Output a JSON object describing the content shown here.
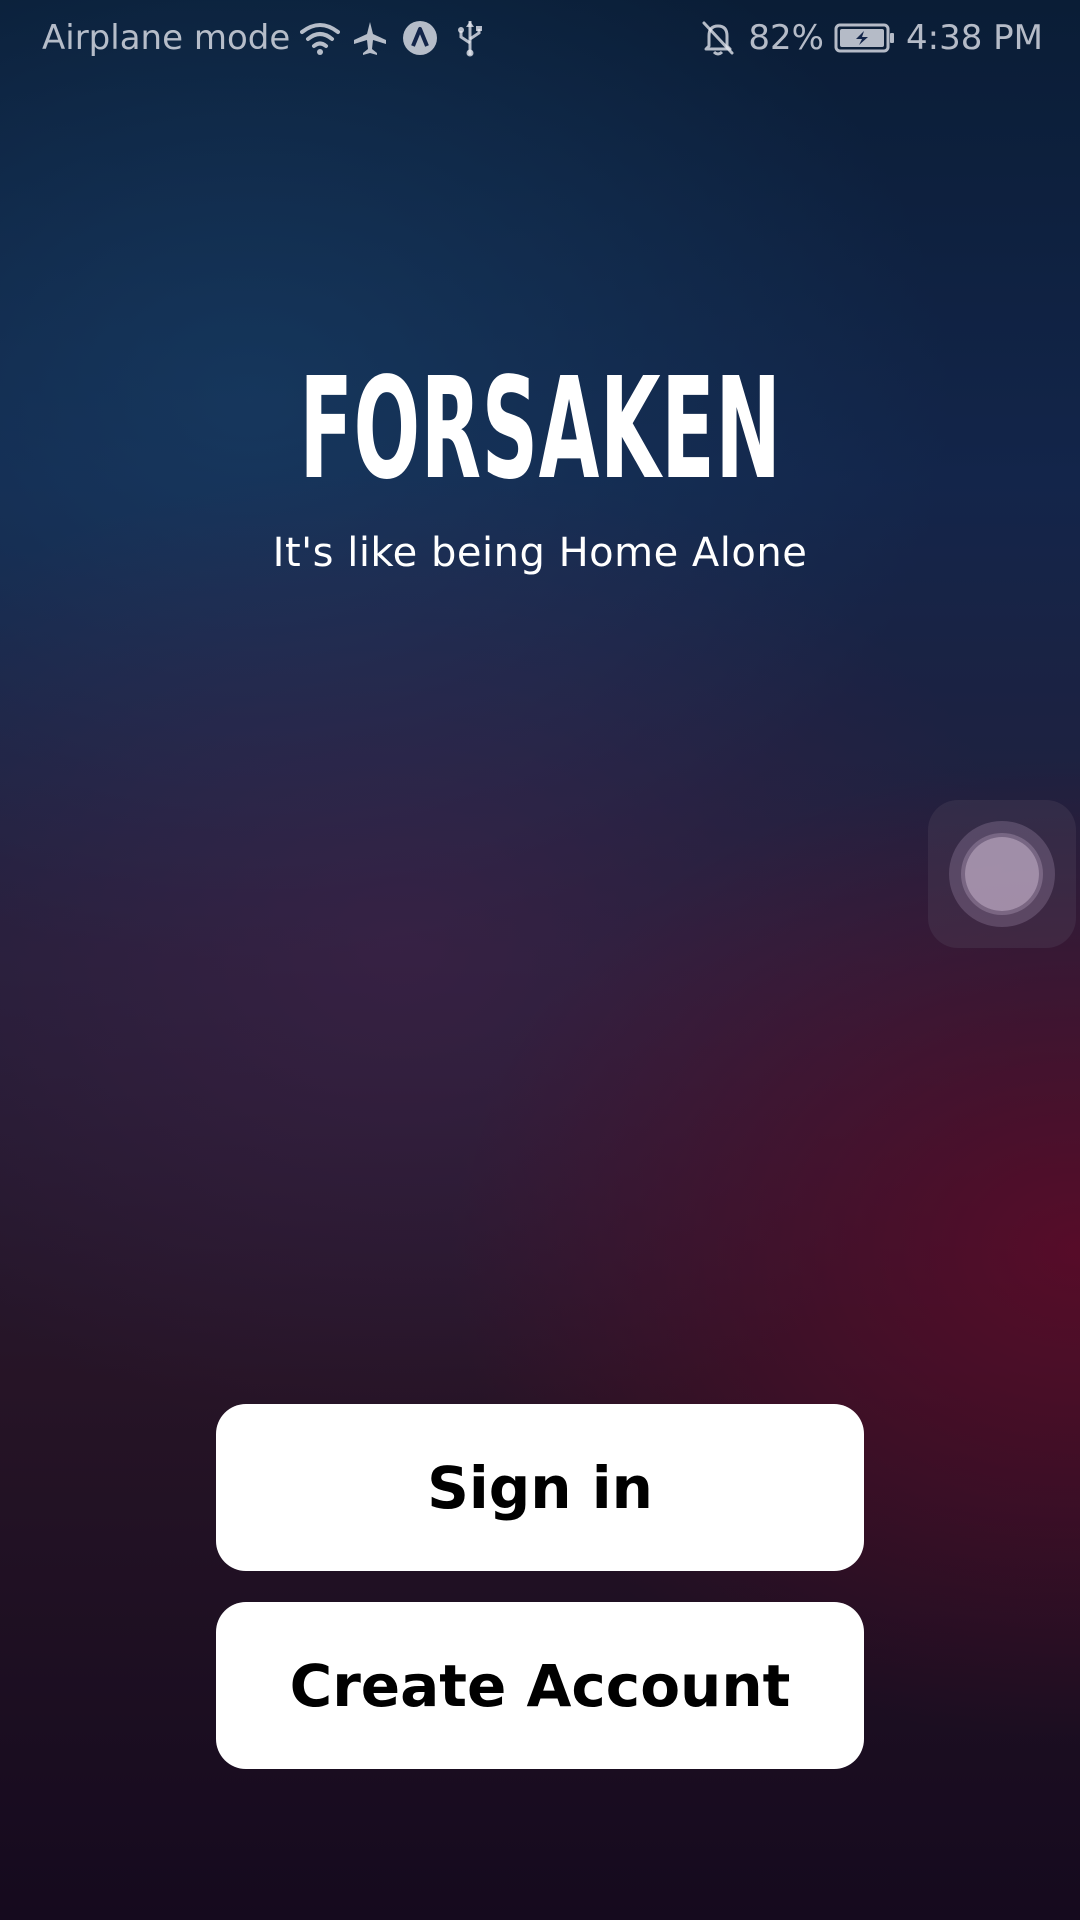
{
  "status_bar": {
    "left_text": "Airplane mode",
    "icons_left": [
      "wifi-icon",
      "airplane-icon",
      "app-notification-icon",
      "usb-icon"
    ],
    "icons_right": [
      "bell-off-icon",
      "battery-charging-icon"
    ],
    "battery_percent": "82%",
    "time": "4:38 PM"
  },
  "brand": {
    "title": "FORSAKEN",
    "tagline": "It's like being Home Alone"
  },
  "actions": {
    "sign_in_label": "Sign in",
    "create_account_label": "Create Account"
  },
  "colors": {
    "button_background": "#ffffff",
    "button_text": "#000000",
    "title_text": "#ffffff",
    "background_top": "#0a1d36",
    "background_bottom": "#150a1e",
    "background_accent": "#5f0a28"
  }
}
